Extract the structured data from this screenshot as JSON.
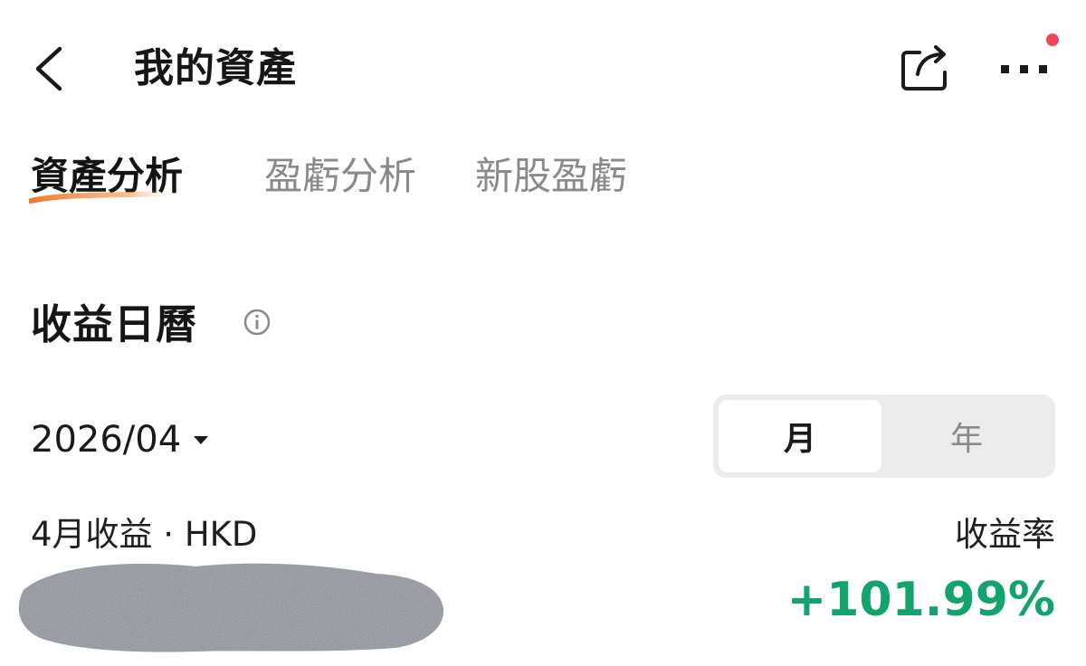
{
  "header": {
    "title": "我的資產",
    "back_icon": "chevron-left-icon",
    "share_icon": "share-icon",
    "more_icon": "more-horizontal-icon",
    "notification_dot_color": "#f0455a"
  },
  "tabs": [
    {
      "label": "資產分析",
      "active": true
    },
    {
      "label": "盈虧分析",
      "active": false
    },
    {
      "label": "新股盈虧",
      "active": false
    }
  ],
  "accent_color": "#f08a3e",
  "section": {
    "title": "收益日曆",
    "info_icon": "info-icon"
  },
  "date_picker": {
    "value": "2026/04",
    "caret_icon": "caret-down-icon"
  },
  "period_toggle": {
    "options": [
      "月",
      "年"
    ],
    "selected": "月"
  },
  "income": {
    "label": "4月收益 · HKD",
    "value_redacted": true
  },
  "yield": {
    "label": "收益率",
    "value": "+101.99%",
    "color": "#13a36d"
  }
}
